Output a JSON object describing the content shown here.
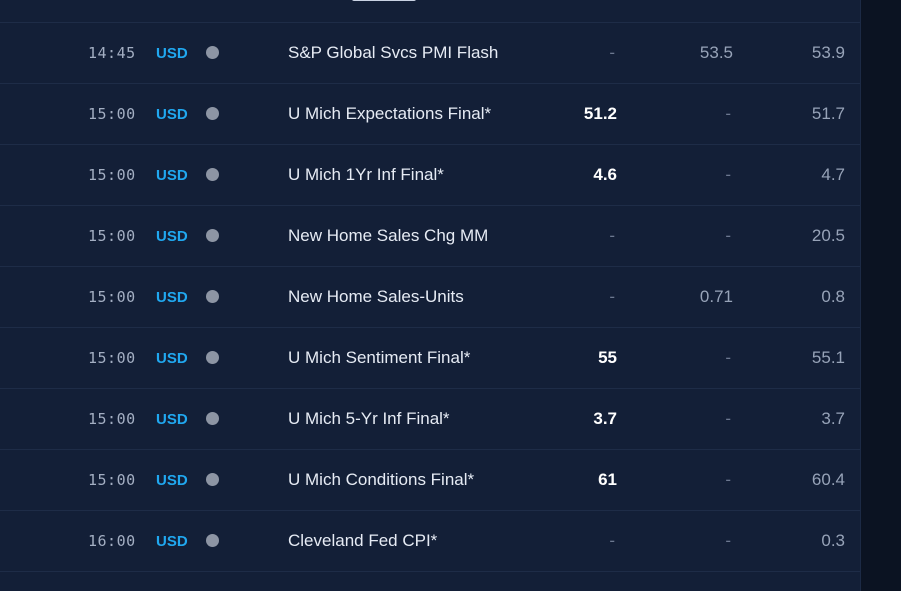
{
  "colors": {
    "background": "#131f37",
    "row_divider": "#1e2c47",
    "currency": "#20a8f0",
    "impact_dot": "#8d95a4",
    "actual_text": "#ffffff",
    "secondary_text": "#97a3b8"
  },
  "calendar": {
    "rows": [
      {
        "time": "14:45",
        "currency": "USD",
        "impact_icon": "impact-dot-icon",
        "event": "S&P Global Svcs PMI Flash",
        "actual": "-",
        "forecast": "53.5",
        "previous": "53.9"
      },
      {
        "time": "15:00",
        "currency": "USD",
        "impact_icon": "impact-dot-icon",
        "event": "U Mich Expectations Final*",
        "actual": "51.2",
        "forecast": "-",
        "previous": "51.7"
      },
      {
        "time": "15:00",
        "currency": "USD",
        "impact_icon": "impact-dot-icon",
        "event": "U Mich 1Yr Inf Final*",
        "actual": "4.6",
        "forecast": "-",
        "previous": "4.7"
      },
      {
        "time": "15:00",
        "currency": "USD",
        "impact_icon": "impact-dot-icon",
        "event": "New Home Sales Chg MM",
        "actual": "-",
        "forecast": "-",
        "previous": "20.5"
      },
      {
        "time": "15:00",
        "currency": "USD",
        "impact_icon": "impact-dot-icon",
        "event": "New Home Sales-Units",
        "actual": "-",
        "forecast": "0.71",
        "previous": "0.8"
      },
      {
        "time": "15:00",
        "currency": "USD",
        "impact_icon": "impact-dot-icon",
        "event": "U Mich Sentiment Final*",
        "actual": "55",
        "forecast": "-",
        "previous": "55.1"
      },
      {
        "time": "15:00",
        "currency": "USD",
        "impact_icon": "impact-dot-icon",
        "event": "U Mich 5-Yr Inf Final*",
        "actual": "3.7",
        "forecast": "-",
        "previous": "3.7"
      },
      {
        "time": "15:00",
        "currency": "USD",
        "impact_icon": "impact-dot-icon",
        "event": "U Mich Conditions Final*",
        "actual": "61",
        "forecast": "-",
        "previous": "60.4"
      },
      {
        "time": "16:00",
        "currency": "USD",
        "impact_icon": "impact-dot-icon",
        "event": "Cleveland Fed CPI*",
        "actual": "-",
        "forecast": "-",
        "previous": "0.3"
      }
    ]
  }
}
